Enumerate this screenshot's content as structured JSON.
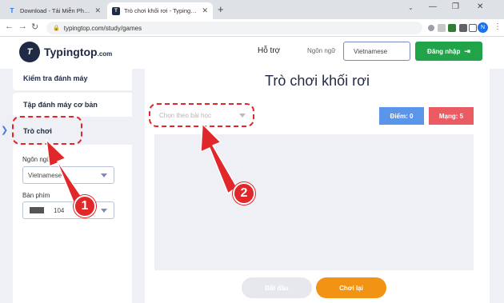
{
  "browser": {
    "tabs": [
      {
        "title": "Download - Tải Miễn Phí VN - Ph",
        "active": false
      },
      {
        "title": "Trò chơi khối rơi - TypingTop",
        "active": true
      }
    ],
    "url": "typingtop.com/study/games"
  },
  "header": {
    "logo_typing": "Typing",
    "logo_top": "top",
    "logo_com": ".com",
    "logo_mark": "T",
    "support": "Hỗ trợ",
    "language_label": "Ngôn ngữ",
    "language_value": "Vietnamese",
    "login": "Đăng nhập"
  },
  "sidebar": {
    "items": [
      {
        "label": "Kiểm tra đánh máy"
      },
      {
        "label": "Tập đánh máy cơ bản"
      },
      {
        "label": "Trò chơi"
      }
    ],
    "language_label": "Ngôn ngữ",
    "language_value": "Vietnamese",
    "keyboard_label": "Bàn phím",
    "keyboard_value": "104"
  },
  "game": {
    "title": "Trò chơi khối rơi",
    "lesson_placeholder": "Chọn theo bài học",
    "score": "Điểm: 0",
    "lives": "Mạng: 5",
    "start": "Bắt đầu",
    "replay": "Chơi lại"
  },
  "annotations": {
    "badge1": "1",
    "badge2": "2",
    "color": "#e0272a"
  }
}
